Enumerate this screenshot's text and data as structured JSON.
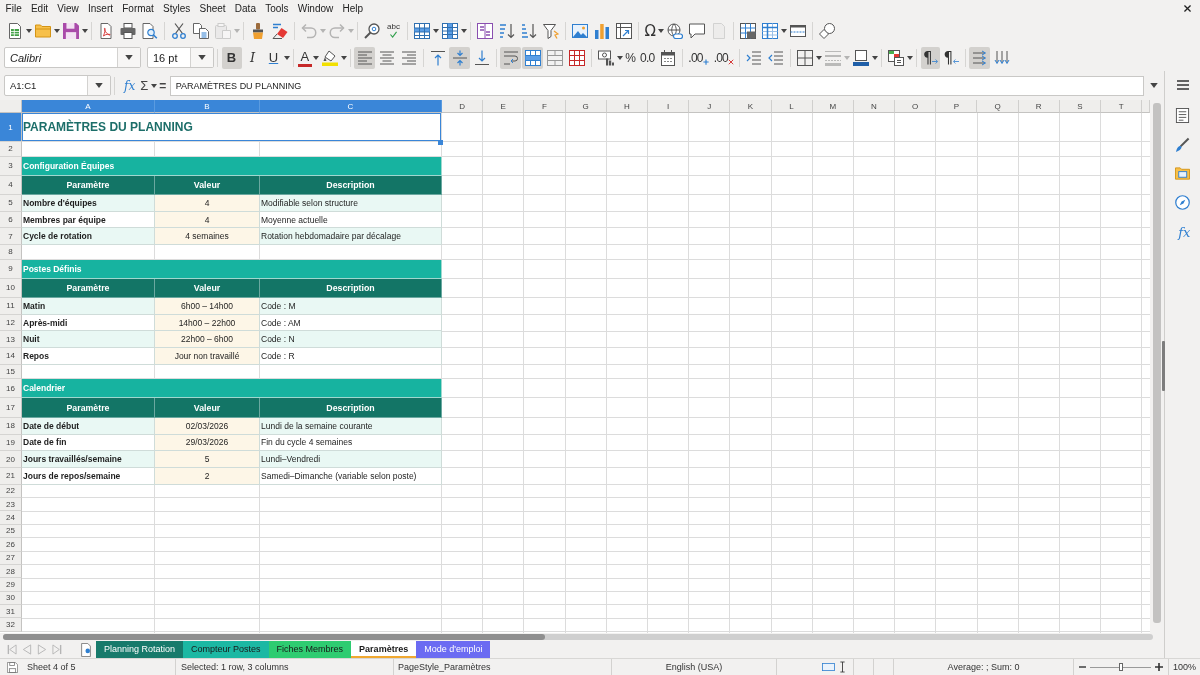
{
  "menu_bar": [
    "File",
    "Edit",
    "View",
    "Insert",
    "Format",
    "Styles",
    "Sheet",
    "Data",
    "Tools",
    "Window",
    "Help"
  ],
  "standard_toolbar": {
    "paste_disabled": true,
    "undo_disabled": true,
    "redo_disabled": true,
    "header_footer_disabled": true,
    "spelling_glyph": "abc",
    "special_character_glyph": "Ω"
  },
  "formatting_toolbar": {
    "font_name": "Calibri",
    "font_size": "16 pt",
    "style_buttons": [
      {
        "glyph": "B",
        "on": true
      },
      {
        "glyph": "I",
        "on": false
      },
      {
        "glyph": "U",
        "on": false
      }
    ],
    "font_color_glyph": "A",
    "horizontal_align": [
      {
        "on": true
      },
      {
        "on": false
      },
      {
        "on": false
      }
    ],
    "vertical_align": [
      {
        "on": false
      },
      {
        "on": true
      },
      {
        "on": false
      }
    ],
    "wrap_text_on": true,
    "merge_and_center_on": true,
    "percent_glyph": "%",
    "number_format_glyph": "0.0",
    "decimal_glyphs": [
      ".00",
      ".00"
    ],
    "border_style_disabled": true,
    "paragraph_direction": [
      {
        "glyph": "¶",
        "on": true
      },
      {
        "glyph": "¶",
        "on": false
      }
    ],
    "text_direction": [
      {
        "on": true
      },
      {
        "on": false
      }
    ]
  },
  "formula_bar": {
    "name_box": "A1:C1",
    "function_wizard_glyph": "fx",
    "sum_glyph": "Σ",
    "formula_glyph": "=",
    "content": "PARAMÈTRES DU PLANNING"
  },
  "sidebar": {
    "functions_glyph": "fx"
  },
  "sheet": {
    "columns": [
      {
        "label": "A",
        "selected": true
      },
      {
        "label": "B",
        "selected": true
      },
      {
        "label": "C",
        "selected": true
      },
      {
        "label": "D",
        "selected": false
      },
      {
        "label": "E",
        "selected": false
      },
      {
        "label": "F",
        "selected": false
      },
      {
        "label": "G",
        "selected": false
      },
      {
        "label": "H",
        "selected": false
      },
      {
        "label": "I",
        "selected": false
      },
      {
        "label": "J",
        "selected": false
      },
      {
        "label": "K",
        "selected": false
      },
      {
        "label": "L",
        "selected": false
      },
      {
        "label": "M",
        "selected": false
      },
      {
        "label": "N",
        "selected": false
      },
      {
        "label": "O",
        "selected": false
      },
      {
        "label": "P",
        "selected": false
      },
      {
        "label": "Q",
        "selected": false
      },
      {
        "label": "R",
        "selected": false
      },
      {
        "label": "S",
        "selected": false
      },
      {
        "label": "T",
        "selected": false
      }
    ],
    "rows": [
      {
        "label": "1",
        "selected": true
      },
      {
        "label": "2",
        "selected": false
      },
      {
        "label": "3",
        "selected": false
      },
      {
        "label": "4",
        "selected": false
      },
      {
        "label": "5",
        "selected": false
      },
      {
        "label": "6",
        "selected": false
      },
      {
        "label": "7",
        "selected": false
      },
      {
        "label": "8",
        "selected": false
      },
      {
        "label": "9",
        "selected": false
      },
      {
        "label": "10",
        "selected": false
      },
      {
        "label": "11",
        "selected": false
      },
      {
        "label": "12",
        "selected": false
      },
      {
        "label": "13",
        "selected": false
      },
      {
        "label": "14",
        "selected": false
      },
      {
        "label": "15",
        "selected": false
      },
      {
        "label": "16",
        "selected": false
      },
      {
        "label": "17",
        "selected": false
      },
      {
        "label": "18",
        "selected": false
      },
      {
        "label": "19",
        "selected": false
      },
      {
        "label": "20",
        "selected": false
      },
      {
        "label": "21",
        "selected": false
      },
      {
        "label": "22",
        "selected": false
      },
      {
        "label": "23",
        "selected": false
      },
      {
        "label": "24",
        "selected": false
      },
      {
        "label": "25",
        "selected": false
      },
      {
        "label": "26",
        "selected": false
      },
      {
        "label": "27",
        "selected": false
      },
      {
        "label": "28",
        "selected": false
      },
      {
        "label": "29",
        "selected": false
      },
      {
        "label": "30",
        "selected": false
      },
      {
        "label": "31",
        "selected": false
      },
      {
        "label": "32",
        "selected": false
      }
    ],
    "title": {
      "text": "PARAMÈTRES DU PLANNING",
      "selected": true
    },
    "sections": [
      {
        "title": "Configuration Équipes",
        "header": [
          "Paramètre",
          "Valeur",
          "Description"
        ],
        "rows": [
          [
            "Nombre d'équipes",
            "4",
            "Modifiable selon structure"
          ],
          [
            "Membres par équipe",
            "4",
            "Moyenne actuelle"
          ],
          [
            "Cycle de rotation",
            "4 semaines",
            "Rotation hebdomadaire par décalage"
          ]
        ]
      },
      {
        "title": "Postes Définis",
        "header": [
          "Paramètre",
          "Valeur",
          "Description"
        ],
        "rows": [
          [
            "Matin",
            "6h00 – 14h00",
            "Code : M"
          ],
          [
            "Après-midi",
            "14h00 – 22h00",
            "Code : AM"
          ],
          [
            "Nuit",
            "22h00 – 6h00",
            "Code : N"
          ],
          [
            "Repos",
            "Jour non travaillé",
            "Code : R"
          ]
        ]
      },
      {
        "title": "Calendrier",
        "header": [
          "Paramètre",
          "Valeur",
          "Description"
        ],
        "rows": [
          [
            "Date de début",
            "02/03/2026",
            "Lundi de la semaine courante"
          ],
          [
            "Date de fin",
            "29/03/2026",
            "Fin du cycle 4 semaines"
          ],
          [
            "Jours travaillés/semaine",
            "5",
            "Lundi–Vendredi"
          ],
          [
            "Jours de repos/semaine",
            "2",
            "Samedi–Dimanche (variable selon poste)"
          ]
        ]
      }
    ]
  },
  "sheet_tabs": [
    {
      "label": "Planning Rotation",
      "color": "#177a6b",
      "selected": false
    },
    {
      "label": "Compteur Postes",
      "color": "#1cb8a3",
      "selected": false
    },
    {
      "label": "Fiches Membres",
      "color": "#2ecc71",
      "selected": false
    },
    {
      "label": "Paramètres",
      "color": "#f0a830",
      "selected": true
    },
    {
      "label": "Mode d'emploi",
      "color": "#6b6bf2",
      "selected": false
    }
  ],
  "status_bar": {
    "sheet": "Sheet 4 of 5",
    "selection": "Selected: 1 row, 3 columns",
    "page_style": "PageStyle_Paramètres",
    "language": "English (USA)",
    "statistics": "Average: ; Sum: 0",
    "zoom": {
      "level": 0.5,
      "reading": "100%"
    }
  }
}
